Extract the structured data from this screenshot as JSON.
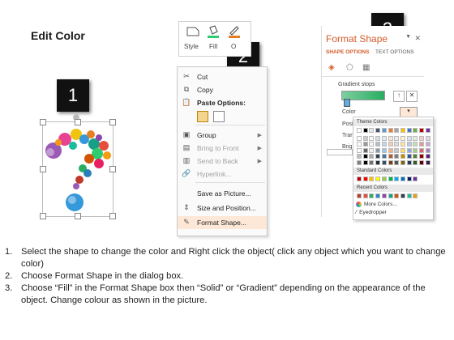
{
  "title": "Edit Color",
  "steps": [
    "1",
    "2",
    "3"
  ],
  "ribbon": {
    "style": "Style",
    "fill": "Fill",
    "outline_partial": "O"
  },
  "context_menu": {
    "cut": "Cut",
    "copy": "Copy",
    "paste_options": "Paste Options:",
    "group": "Group",
    "bring_to_front": "Bring to Front",
    "send_to_back": "Send to Back",
    "hyperlink": "Hyperlink...",
    "save_as_picture": "Save as Picture...",
    "size_and_position": "Size and Position...",
    "format_shape": "Format Shape..."
  },
  "format_pane": {
    "title": "Format Shape",
    "tab_shape_options": "SHAPE OPTIONS",
    "tab_text_options": "TEXT OPTIONS",
    "gradient_stops": "Gradient stops",
    "color": "Color",
    "position_partial": "Posi",
    "transparency_partial": "Tran",
    "brightness_partial": "Brigh"
  },
  "color_picker": {
    "theme_colors": "Theme Colors",
    "standard_colors": "Standard Colors",
    "recent_colors": "Recent Colors",
    "more_colors": "More Colors...",
    "eyedropper": "Eyedropper",
    "theme_top": [
      "#ffffff",
      "#000000",
      "#e7e6e6",
      "#44546a",
      "#5b9bd5",
      "#ed7d31",
      "#a5a5a5",
      "#ffc000",
      "#4472c4",
      "#70ad47",
      "#c00000",
      "#7030a0"
    ],
    "standard": [
      "#c00000",
      "#ff0000",
      "#ffc000",
      "#ffff00",
      "#92d050",
      "#00b050",
      "#00b0f0",
      "#0070c0",
      "#002060",
      "#7030a0"
    ],
    "recent": [
      "#c0392b",
      "#e74c3c",
      "#27ae60",
      "#2e86c1",
      "#8e44ad",
      "#16a085",
      "#d35400",
      "#2c3e50",
      "#1abc9c",
      "#f39c12"
    ]
  },
  "instructions": [
    {
      "num": "1.",
      "text": "Select the shape to change the color and Right click the object( click any object which you want to change color)"
    },
    {
      "num": "2.",
      "text": "Choose Format Shape in the dialog box."
    },
    {
      "num": "3.",
      "text": "Choose “Fill” in the Format Shape box then “Solid” or “Gradient” depending on the appearance of the object. Change colour as shown in the picture."
    }
  ]
}
